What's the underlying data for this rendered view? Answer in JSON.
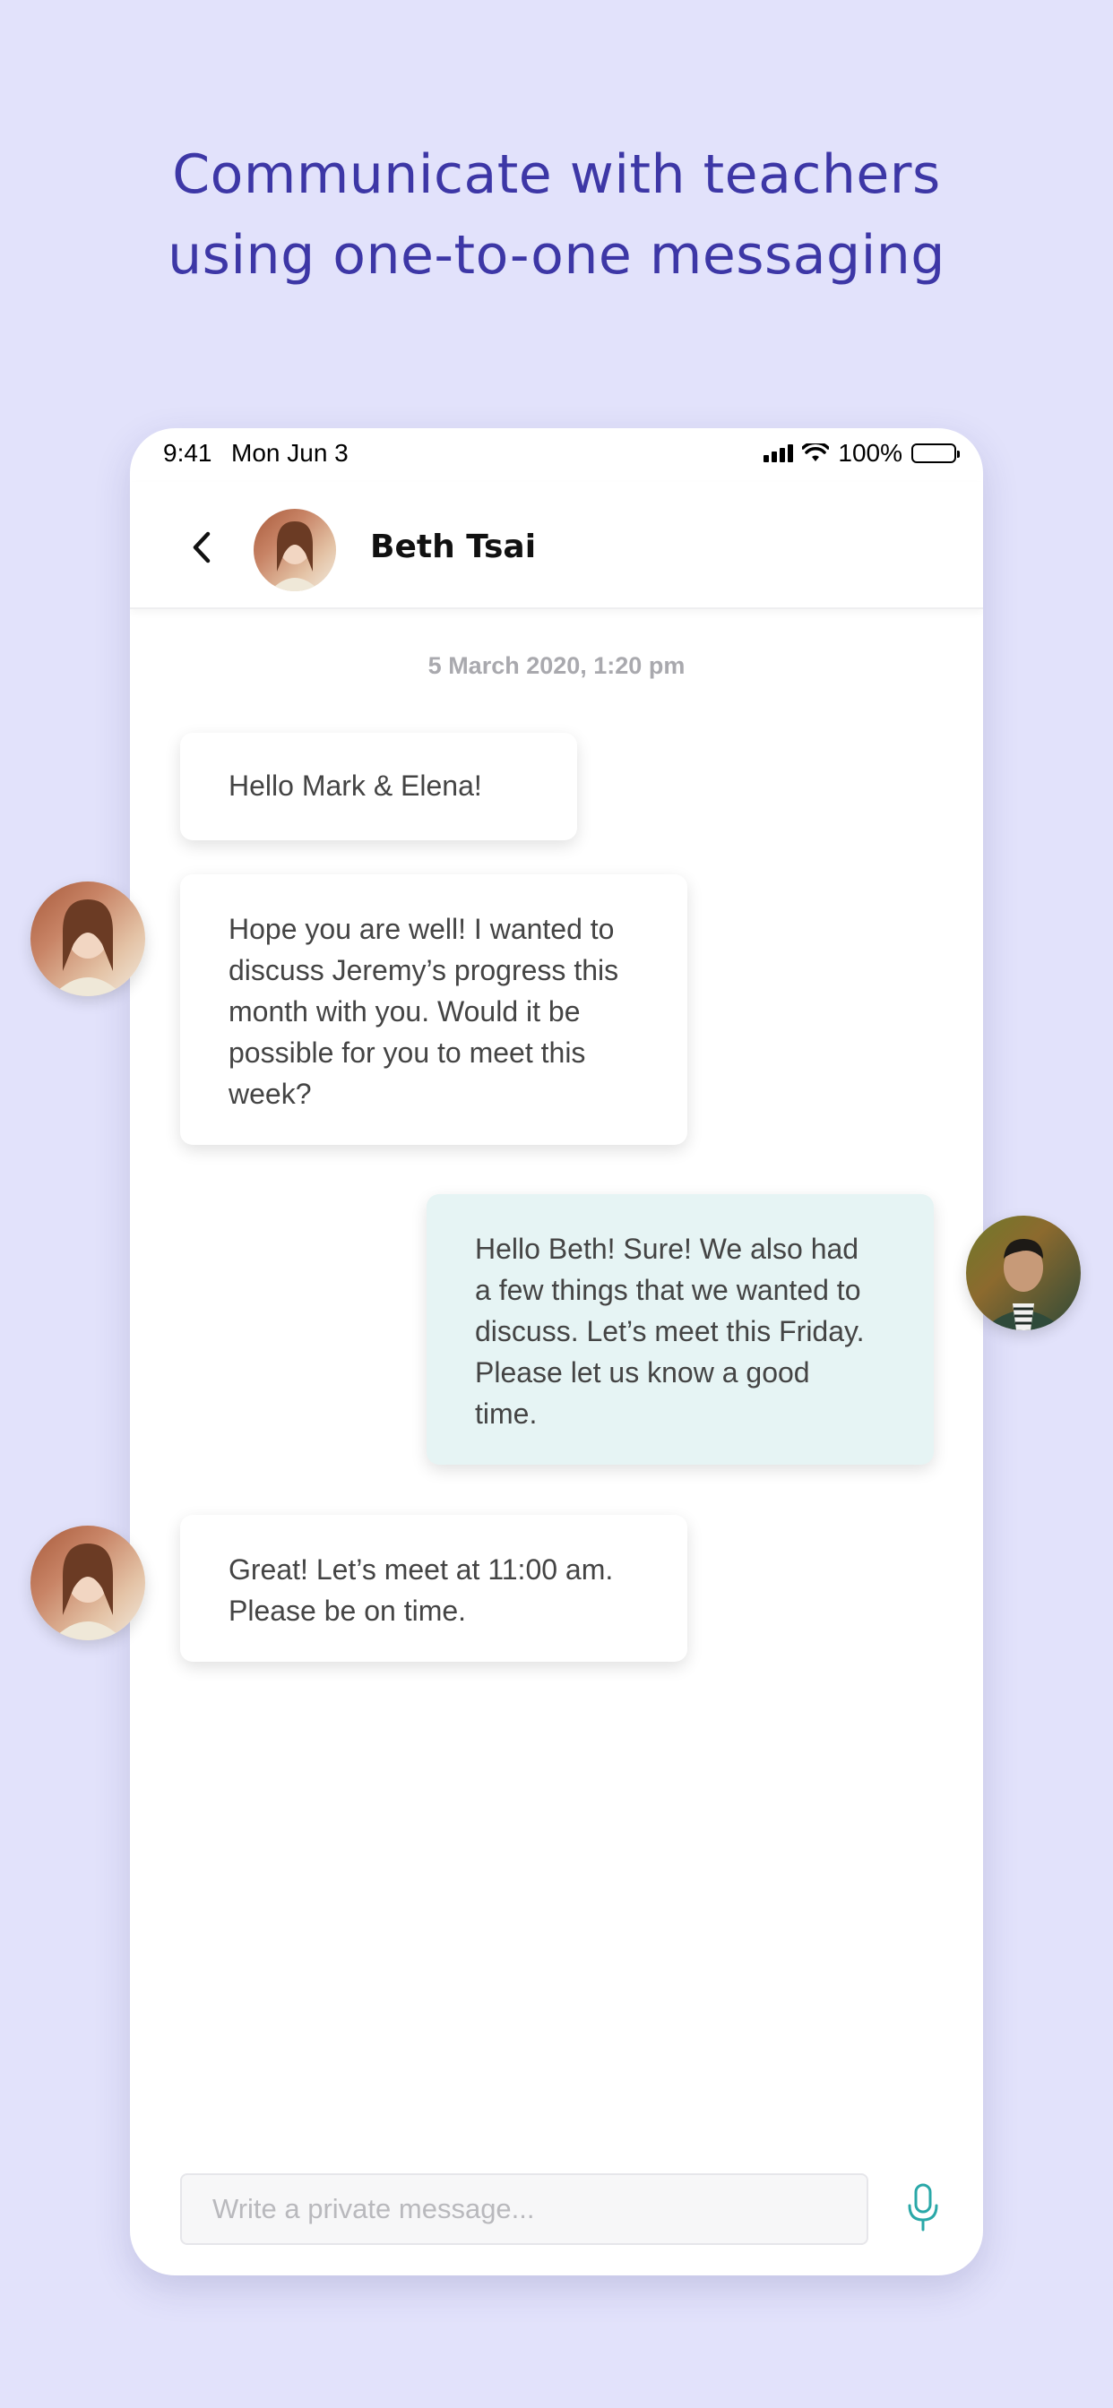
{
  "headline": {
    "line1": "Communicate with teachers",
    "line2": "using one-to-one messaging"
  },
  "status_bar": {
    "time": "9:41",
    "date": "Mon Jun 3",
    "battery": "100%",
    "icons": [
      "signal-icon",
      "wifi-icon",
      "battery-icon"
    ]
  },
  "conversation": {
    "contact_name": "Beth Tsai",
    "timestamp": "5 March 2020, 1:20 pm",
    "messages": [
      {
        "from": "Beth Tsai",
        "text": "Hello Mark & Elena!"
      },
      {
        "from": "Beth Tsai",
        "text": "Hope you are well! I wanted to\ndiscuss Jeremy’s progress this\nmonth with you. Would it be\npossible for you to meet this\nweek?"
      },
      {
        "from": "me",
        "text": "Hello Beth! Sure! We also had\na few things that we wanted to\ndiscuss. Let’s meet this Friday.\nPlease let us know a good\ntime."
      },
      {
        "from": "Beth Tsai",
        "text": "Great! Let’s meet at 11:00 am.\nPlease be on time."
      }
    ]
  },
  "composer": {
    "placeholder": "Write a private message..."
  },
  "colors": {
    "page_background": "#e2e2fb",
    "headline": "#3d37a6",
    "sent_bubble": "#e6f4f4",
    "mic_accent": "#2aa8a8"
  }
}
